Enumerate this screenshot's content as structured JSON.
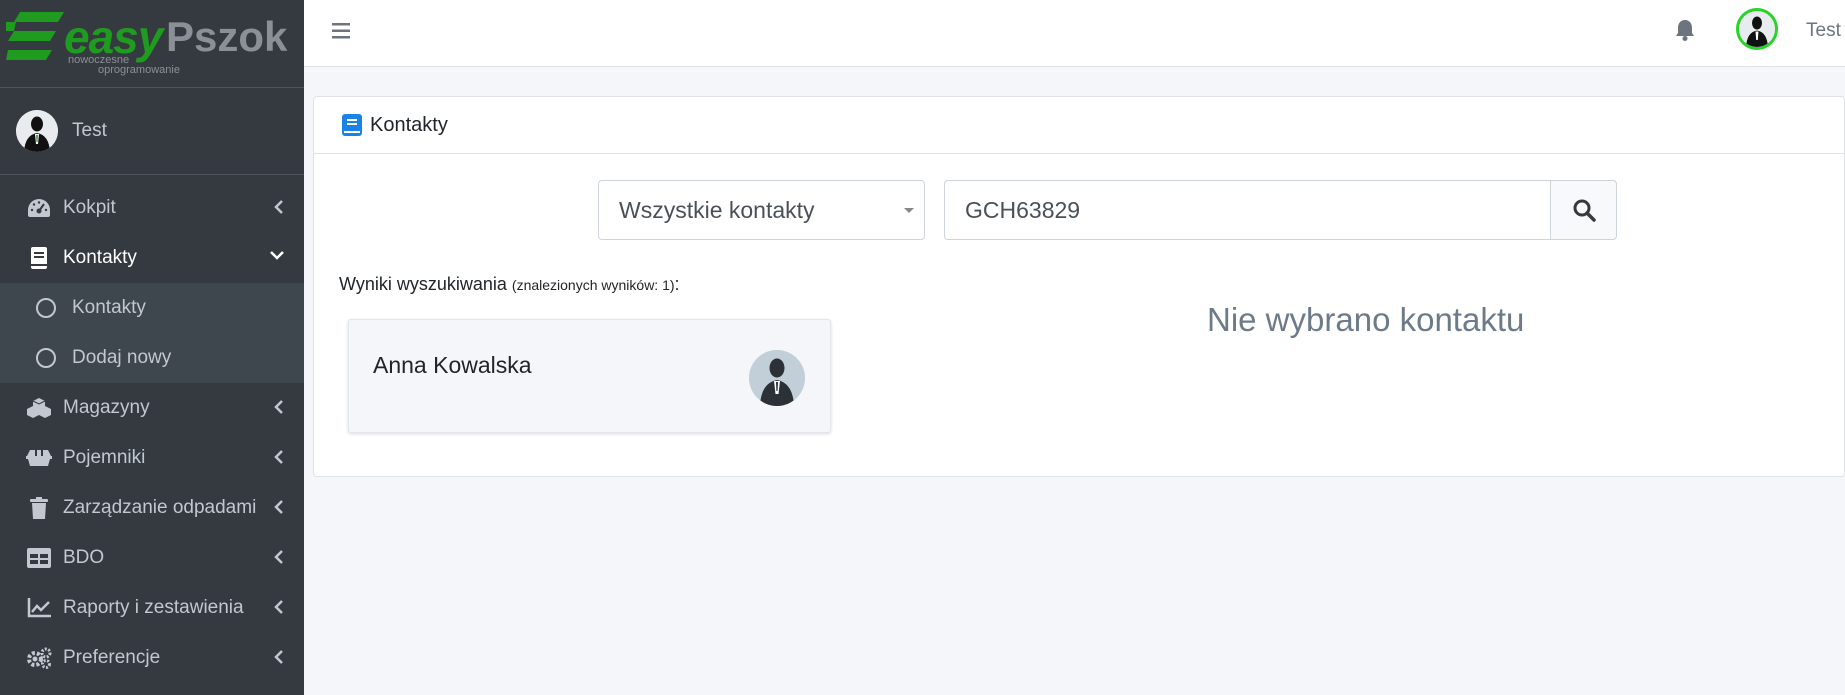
{
  "brand": {
    "word1": "easy",
    "word2": "Pszok",
    "tagline1": "nowoczesne",
    "tagline2": "oprogramowanie",
    "color_green": "#1f9b1f"
  },
  "user": {
    "name": "Test"
  },
  "sidebar": {
    "items": [
      {
        "label": "Kokpit",
        "icon": "tachometer-icon"
      },
      {
        "label": "Kontakty",
        "icon": "address-book-icon",
        "open": true,
        "children": [
          {
            "label": "Kontakty",
            "icon": "circle-icon"
          },
          {
            "label": "Dodaj nowy",
            "icon": "circle-icon"
          }
        ]
      },
      {
        "label": "Magazyny",
        "icon": "cubes-icon"
      },
      {
        "label": "Pojemniki",
        "icon": "dumpster-icon"
      },
      {
        "label": "Zarządzanie odpadami",
        "icon": "trash-icon"
      },
      {
        "label": "BDO",
        "icon": "table-icon"
      },
      {
        "label": "Raporty i zestawienia",
        "icon": "chart-line-icon"
      },
      {
        "label": "Preferencje",
        "icon": "cogs-icon"
      }
    ]
  },
  "topbar": {
    "username": "Test"
  },
  "card": {
    "title": "Kontakty",
    "filter_select": {
      "selected": "Wszystkie kontakty"
    },
    "search": {
      "value": "GCH63829"
    },
    "results_label": "Wyniki wyszukiwania",
    "results_count": "(znalezionych wyników: 1)",
    "results_suffix": ":",
    "results": [
      {
        "name": "Anna Kowalska"
      }
    ],
    "empty_detail": "Nie wybrano kontaktu"
  }
}
